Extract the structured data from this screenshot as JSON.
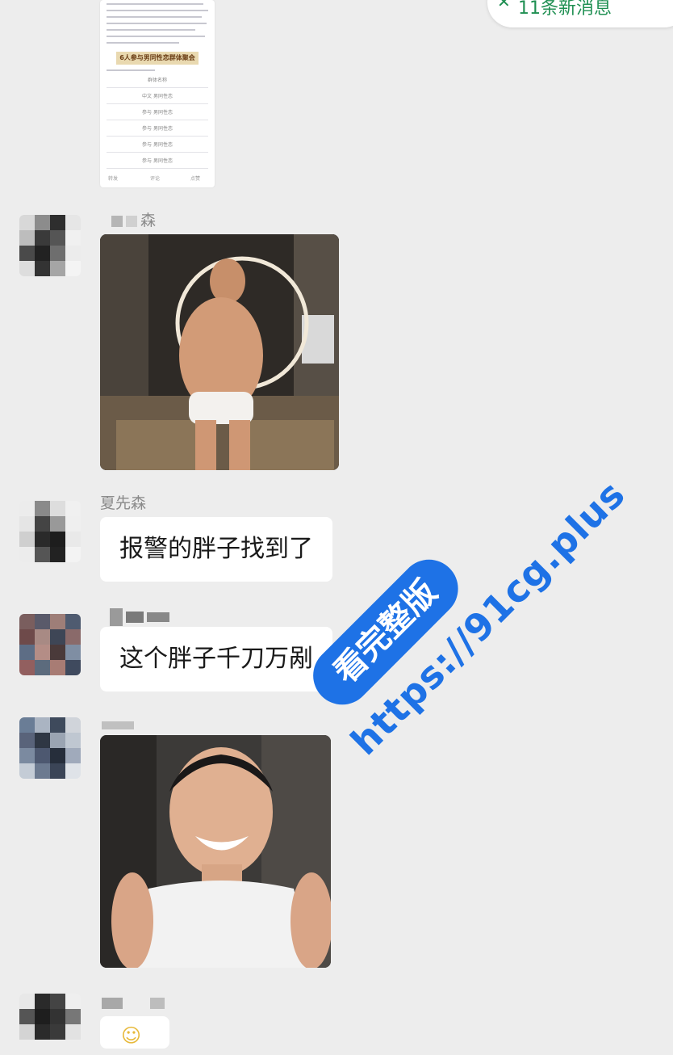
{
  "header": {
    "new_messages_label": "11条新消息",
    "close_icon": "close-icon"
  },
  "messages": [
    {
      "type": "document",
      "title": "6人参与男同性恋群体聚会",
      "rows": [
        "群体名称",
        "中文 男同性恋",
        "参与 男同性恋",
        "参与 男同性恋",
        "参与 男同性恋",
        "参与 男同性恋",
        "参与 男同性恋"
      ],
      "footer": [
        "转发",
        "评论",
        "点赞"
      ]
    },
    {
      "type": "image",
      "sender": "森",
      "description": "man in white briefs in front of ring light"
    },
    {
      "type": "text",
      "sender": "夏先森",
      "text": "报警的胖子找到了"
    },
    {
      "type": "text",
      "sender": "",
      "text": "这个胖子千刀万剐"
    },
    {
      "type": "image",
      "sender": "",
      "description": "smiling young man in white tank top"
    }
  ],
  "watermark": {
    "badge": "看完整版",
    "url": "https://91cg.plus",
    "color": "#1e72e6"
  }
}
